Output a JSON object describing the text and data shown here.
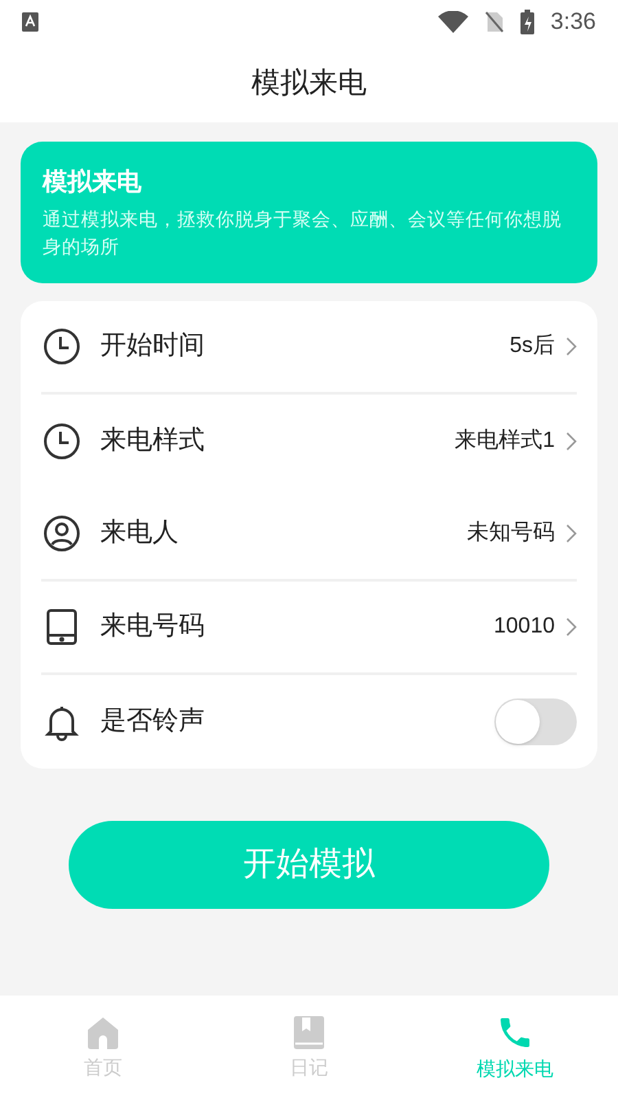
{
  "status_bar": {
    "time": "3:36"
  },
  "header": {
    "title": "模拟来电"
  },
  "banner": {
    "title": "模拟来电",
    "description": "通过模拟来电，拯救你脱身于聚会、应酬、会议等任何你想脱身的场所"
  },
  "settings": [
    {
      "kind": "link",
      "label": "开始时间",
      "value": "5s后",
      "divider": true
    },
    {
      "kind": "link",
      "label": "来电样式",
      "value": "来电样式1",
      "divider": false
    },
    {
      "kind": "link",
      "label": "来电人",
      "value": "未知号码",
      "divider": true
    },
    {
      "kind": "link",
      "label": "来电号码",
      "value": "10010",
      "divider": true
    },
    {
      "kind": "toggle",
      "label": "是否铃声",
      "on": false,
      "divider": false
    }
  ],
  "start_button": {
    "label": "开始模拟"
  },
  "bottom_nav": [
    {
      "label": "首页",
      "selected": false
    },
    {
      "label": "日记",
      "selected": false
    },
    {
      "label": "模拟来电",
      "selected": true
    }
  ]
}
